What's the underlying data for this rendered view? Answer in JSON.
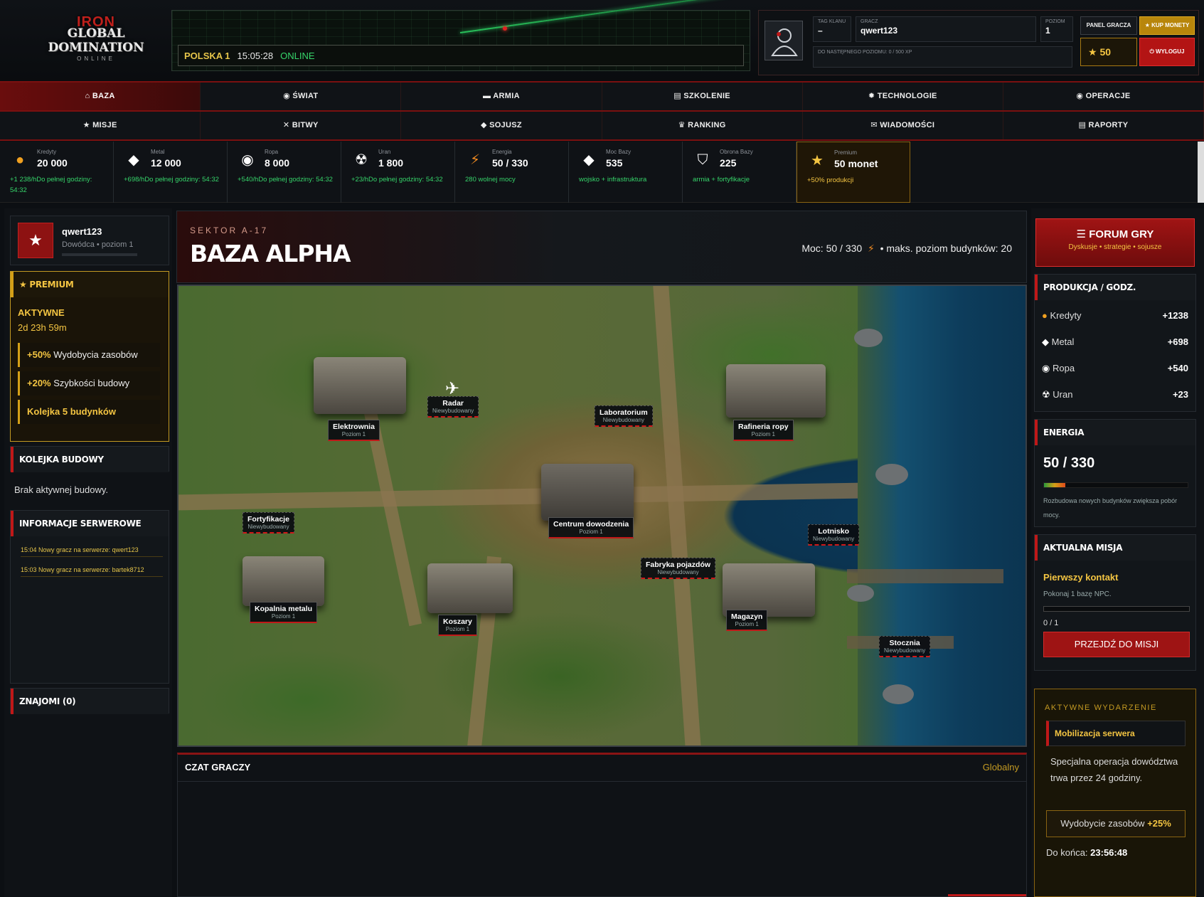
{
  "header": {
    "logo": {
      "top": "IRON",
      "middle": "GLOBAL DOMINATION",
      "bottom": "ONLINE"
    },
    "server": {
      "name": "POLSKA 1",
      "time": "15:05:28",
      "status": "ONLINE"
    },
    "clan_tag": {
      "label": "TAG KLANU",
      "value": "–"
    },
    "player": {
      "label": "GRACZ",
      "value": "qwert123"
    },
    "level": {
      "label": "POZIOM",
      "value": "1"
    },
    "xp_text": "DO NASTĘPNEGO POZIOMU: 0 / 500 XP",
    "panel_button": "PANEL GRACZA",
    "buy_button": "★ KUP MONETY",
    "coins": "★ 50",
    "logout_button": "⏻ WYLOGUJ"
  },
  "nav": {
    "row1": [
      "⌂ BAZA",
      "◉ ŚWIAT",
      "▬ ARMIA",
      "▤ SZKOLENIE",
      "✹ TECHNOLOGIE",
      "◉ OPERACJE"
    ],
    "row2": [
      "★ MISJE",
      "✕ BITWY",
      "◆ SOJUSZ",
      "♛ RANKING",
      "✉ WIADOMOŚCI",
      "▤ RAPORTY"
    ]
  },
  "resources": [
    {
      "label": "Kredyty",
      "value": "20 000",
      "sub": "+1 238/hDo pełnej godziny: 54:32",
      "icon": "coin-icon",
      "glyph": "●",
      "color": "#f0a020"
    },
    {
      "label": "Metal",
      "value": "12 000",
      "sub": "+698/hDo pełnej godziny: 54:32",
      "icon": "metal-icon",
      "glyph": "◆",
      "color": "#ffffff"
    },
    {
      "label": "Ropa",
      "value": "8 000",
      "sub": "+540/hDo pełnej godziny: 54:32",
      "icon": "oil-icon",
      "glyph": "◉",
      "color": "#ffffff"
    },
    {
      "label": "Uran",
      "value": "1 800",
      "sub": "+23/hDo pełnej godziny: 54:32",
      "icon": "radiation-icon",
      "glyph": "☢",
      "color": "#ffffff"
    },
    {
      "label": "Energia",
      "value": "50 / 330",
      "sub": "280 wolnej mocy",
      "icon": "lightning-icon",
      "glyph": "⚡",
      "color": "#f08a20"
    },
    {
      "label": "Moc Bazy",
      "value": "535",
      "sub": "wojsko + infrastruktura",
      "icon": "diamond-icon",
      "glyph": "◆",
      "color": "#ffffff"
    },
    {
      "label": "Obrona Bazy",
      "value": "225",
      "sub": "armia + fortyfikacje",
      "icon": "shield-icon",
      "glyph": "⛉",
      "color": "#ffffff"
    },
    {
      "label": "Premium",
      "value": "50 monet",
      "sub": "+50% produkcji",
      "icon": "star-icon",
      "glyph": "★",
      "color": "#f4c542"
    }
  ],
  "left": {
    "user": {
      "badge": "★",
      "name": "qwert123",
      "rank": "Dowódca • poziom 1"
    },
    "premium": {
      "title": "★ PREMIUM",
      "status": "AKTYWNE",
      "time_left": "2d 23h 59m",
      "bonuses": [
        {
          "value": "+50%",
          "text": " Wydobycia zasobów"
        },
        {
          "value": "+20%",
          "text": " Szybkości budowy"
        },
        {
          "value": "Kolejka 5 budynków",
          "text": ""
        }
      ]
    },
    "queue": {
      "title": "KOLEJKA BUDOWY",
      "empty": "Brak aktywnej budowy."
    },
    "server_info": {
      "title": "INFORMACJE SERWEROWE",
      "logs": [
        {
          "time": "15:04",
          "text": "Nowy gracz na serwerze: qwert123"
        },
        {
          "time": "15:03",
          "text": "Nowy gracz na serwerze: bartek8712"
        }
      ]
    },
    "friends": {
      "title": "ZNAJOMI (0)"
    }
  },
  "sector": {
    "label": "SEKTOR A-17",
    "title": "BAZA ALPHA",
    "info_a": "Moc: 50 / 330",
    "info_b": "• maks. poziom budynków: 20"
  },
  "buildings": [
    {
      "name": "Elektrownia",
      "status": "Poziom 1",
      "built": true
    },
    {
      "name": "Radar",
      "status": "Niewybudowany",
      "built": false
    },
    {
      "name": "Laboratorium",
      "status": "Niewybudowany",
      "built": false
    },
    {
      "name": "Rafineria ropy",
      "status": "Poziom 1",
      "built": true
    },
    {
      "name": "Centrum dowodzenia",
      "status": "Poziom 1",
      "built": true
    },
    {
      "name": "Fortyfikacje",
      "status": "Niewybudowany",
      "built": false
    },
    {
      "name": "Lotnisko",
      "status": "Niewybudowany",
      "built": false
    },
    {
      "name": "Fabryka pojazdów",
      "status": "Niewybudowany",
      "built": false
    },
    {
      "name": "Kopalnia metalu",
      "status": "Poziom 1",
      "built": true
    },
    {
      "name": "Koszary",
      "status": "Poziom 1",
      "built": true
    },
    {
      "name": "Magazyn",
      "status": "Poziom 1",
      "built": true
    },
    {
      "name": "Stocznia",
      "status": "Niewybudowany",
      "built": false
    }
  ],
  "chat": {
    "title": "CZAT GRACZY",
    "scope": "Globalny"
  },
  "right": {
    "forum": {
      "title": "☰ FORUM GRY",
      "subtitle": "Dyskusje • strategie • sojusze"
    },
    "production": {
      "title": "PRODUKCJA / GODZ.",
      "rows": [
        {
          "name": "Kredyty",
          "value": "+1238",
          "glyph": "●",
          "color": "#f0a020"
        },
        {
          "name": "Metal",
          "value": "+698",
          "glyph": "◆",
          "color": "#ffffff"
        },
        {
          "name": "Ropa",
          "value": "+540",
          "glyph": "◉",
          "color": "#ffffff"
        },
        {
          "name": "Uran",
          "value": "+23",
          "glyph": "☢",
          "color": "#ffffff"
        }
      ]
    },
    "energy": {
      "title": "ENERGIA",
      "value": "50 / 330",
      "fill_fraction": 0.15,
      "note": "Rozbudowa nowych budynków zwiększa pobór mocy."
    },
    "mission": {
      "title": "AKTUALNA MISJA",
      "name": "Pierwszy kontakt",
      "desc": "Pokonaj 1 bazę NPC.",
      "progress": "0 / 1",
      "button": "PRZEJDŹ DO MISJI"
    },
    "event": {
      "label": "AKTYWNE WYDARZENIE",
      "name": "Mobilizacja serwera",
      "desc": "Specjalna operacja dowództwa trwa przez 24 godziny.",
      "bonus_text": "Wydobycie zasobów ",
      "bonus_value": "+25%",
      "end_label": "Do końca: ",
      "end_value": "23:56:48"
    }
  }
}
